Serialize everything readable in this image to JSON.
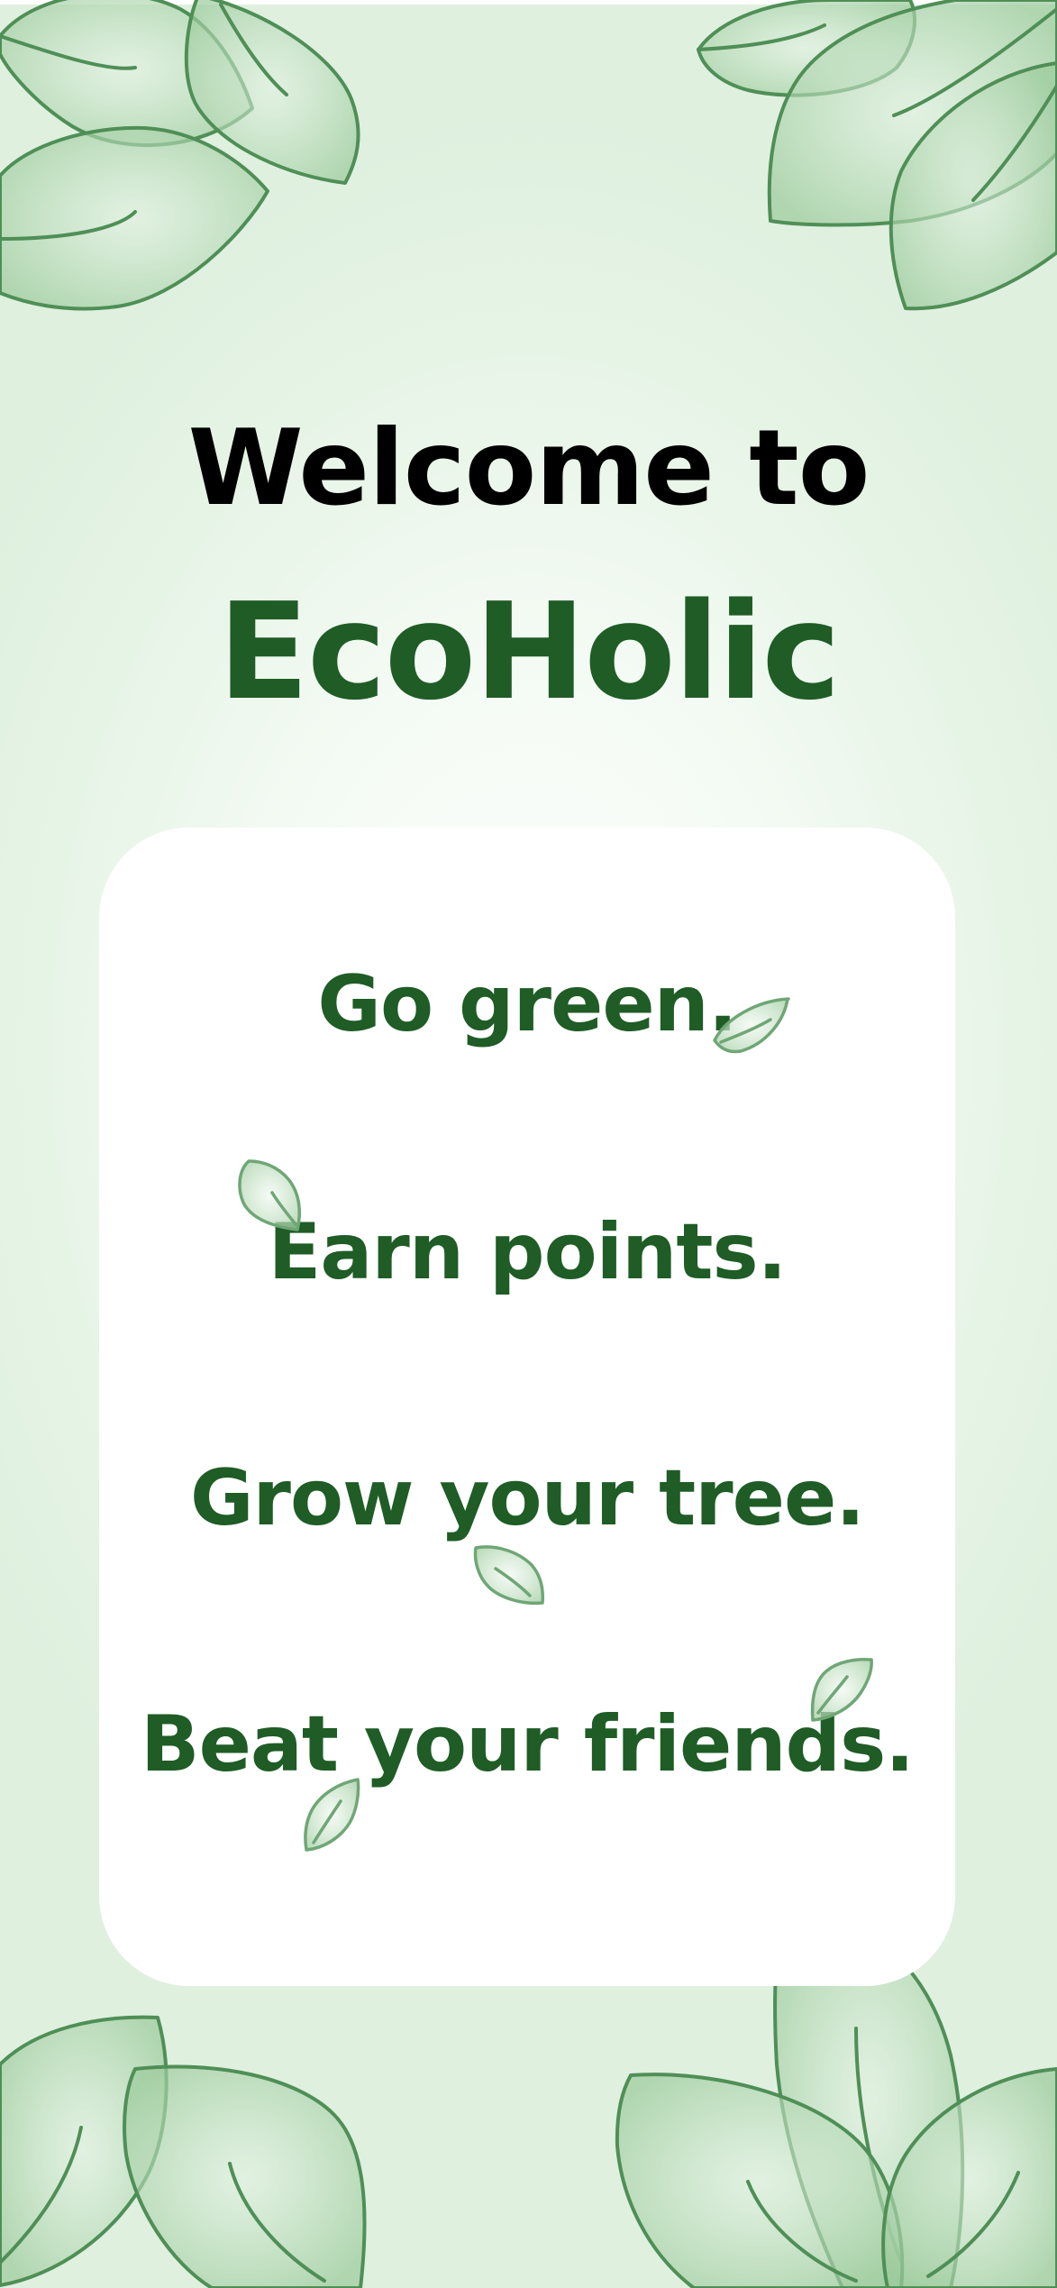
{
  "welcome": {
    "line1": "Welcome to",
    "app_name": "EcoHolic"
  },
  "taglines": [
    "Go green.",
    "Earn points.",
    "Grow your tree.",
    "Beat your friends."
  ],
  "colors": {
    "brand_green": "#1f5c26",
    "leaf_fill": "#b8d9b8",
    "leaf_stroke": "#4a8a52",
    "card_background": "#ffffff"
  },
  "decorations": {
    "icon": "leaf-icon"
  }
}
